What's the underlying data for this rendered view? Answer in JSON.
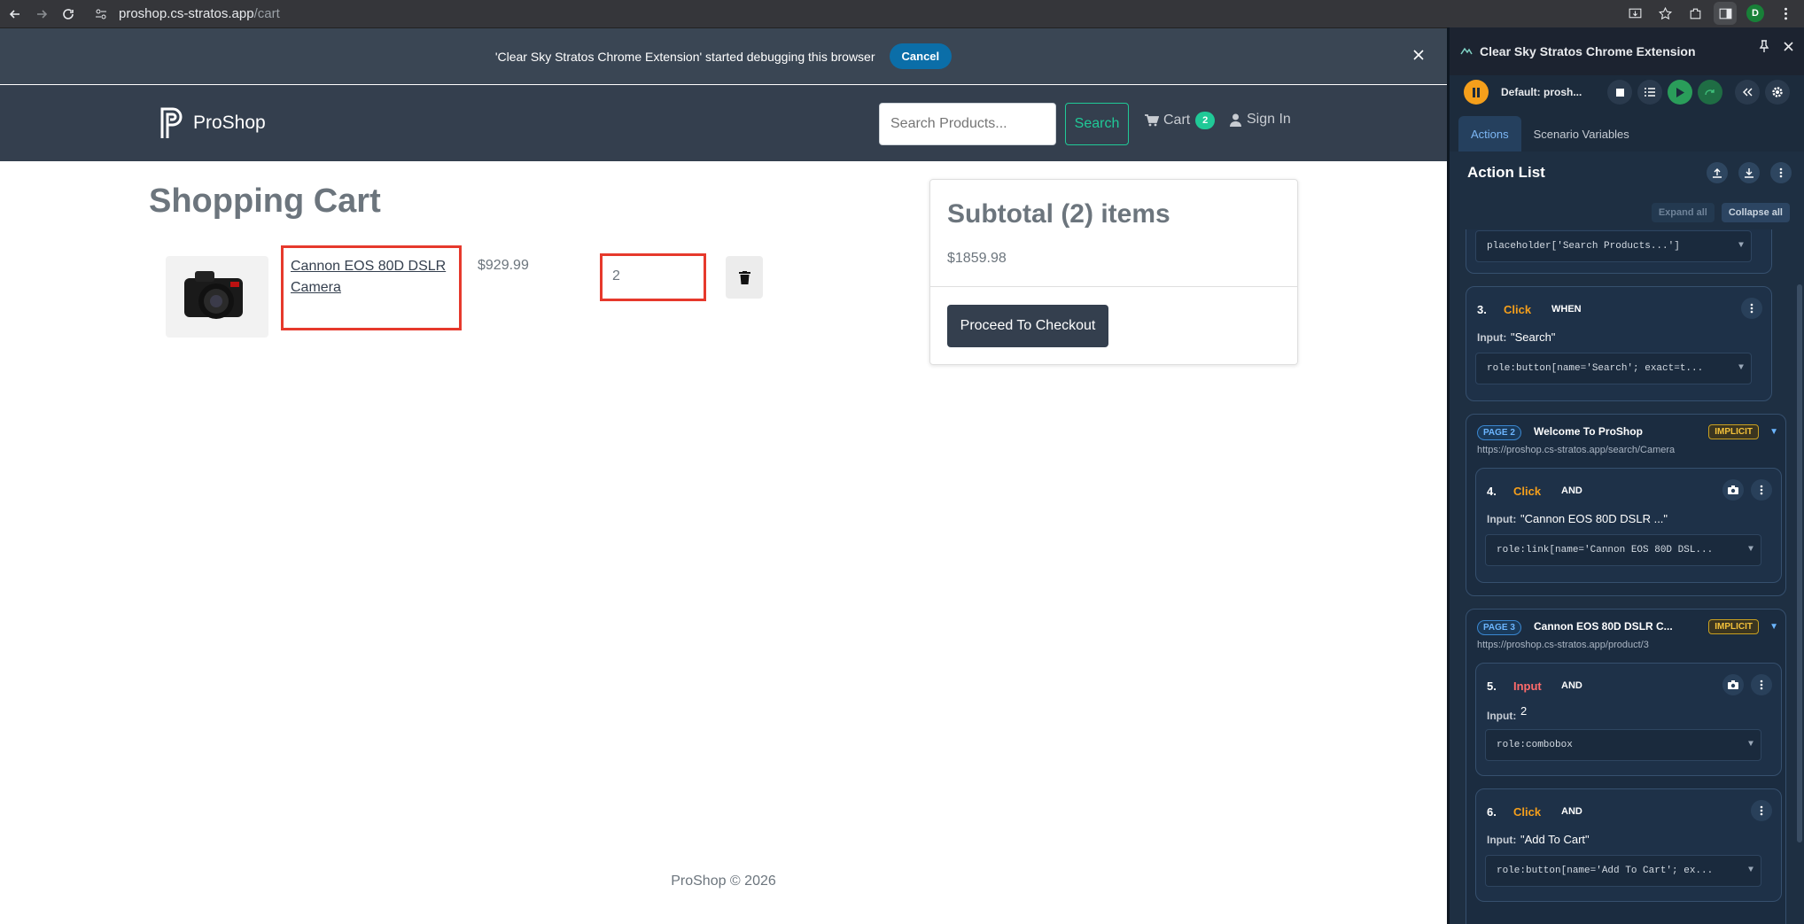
{
  "browser": {
    "url_host": "proshop.cs-stratos.app",
    "url_path": "/cart",
    "profile_initial": "D"
  },
  "debug_bar": {
    "message": "'Clear Sky Stratos Chrome Extension' started debugging this browser",
    "cancel_label": "Cancel"
  },
  "navbar": {
    "brand": "ProShop",
    "search_placeholder": "Search Products...",
    "search_label": "Search",
    "cart_label": "Cart",
    "cart_count": "2",
    "signin_label": "Sign In"
  },
  "cart": {
    "title": "Shopping Cart",
    "items": [
      {
        "name": "Cannon EOS 80D DSLR Camera",
        "price": "$929.99",
        "qty": "2"
      }
    ]
  },
  "summary": {
    "title": "Subtotal (2) items",
    "amount": "$1859.98",
    "checkout_label": "Proceed To Checkout"
  },
  "footer": {
    "text": "ProShop © 2026"
  },
  "extension": {
    "title": "Clear Sky Stratos Chrome Extension",
    "profile_label": "Default: prosh...",
    "tabs": [
      "Actions",
      "Scenario Variables"
    ],
    "action_list_title": "Action List",
    "expand_all": "Expand all",
    "collapse_all": "Collapse all",
    "top_selector": "placeholder['Search Products...']",
    "steps": [
      {
        "num": "3.",
        "action": "Click",
        "conj": "WHEN",
        "input_label": "Input:",
        "input": "\"Search\"",
        "selector": "role:button[name='Search'; exact=t..."
      },
      {
        "num": "4.",
        "action": "Click",
        "conj": "AND",
        "input_label": "Input:",
        "input": "\"Cannon EOS 80D DSLR ...\"",
        "selector": "role:link[name='Cannon EOS 80D DSL..."
      },
      {
        "num": "5.",
        "action": "Input",
        "conj": "AND",
        "input_label": "Input:",
        "input": "2",
        "selector": "role:combobox"
      },
      {
        "num": "6.",
        "action": "Click",
        "conj": "AND",
        "input_label": "Input:",
        "input": "\"Add To Cart\"",
        "selector": "role:button[name='Add To Cart'; ex..."
      }
    ],
    "pages": [
      {
        "badge": "PAGE 2",
        "title": "Welcome To ProShop",
        "tag": "IMPLICIT",
        "url": "https://proshop.cs-stratos.app/search/Camera"
      },
      {
        "badge": "PAGE 3",
        "title": "Cannon EOS 80D DSLR C...",
        "tag": "IMPLICIT",
        "url": "https://proshop.cs-stratos.app/product/3"
      }
    ]
  },
  "colors": {
    "navbar": "#343f4e",
    "accent_teal": "#20c997",
    "highlight_red": "#e6392c",
    "ext_orange": "#f59f1b"
  }
}
